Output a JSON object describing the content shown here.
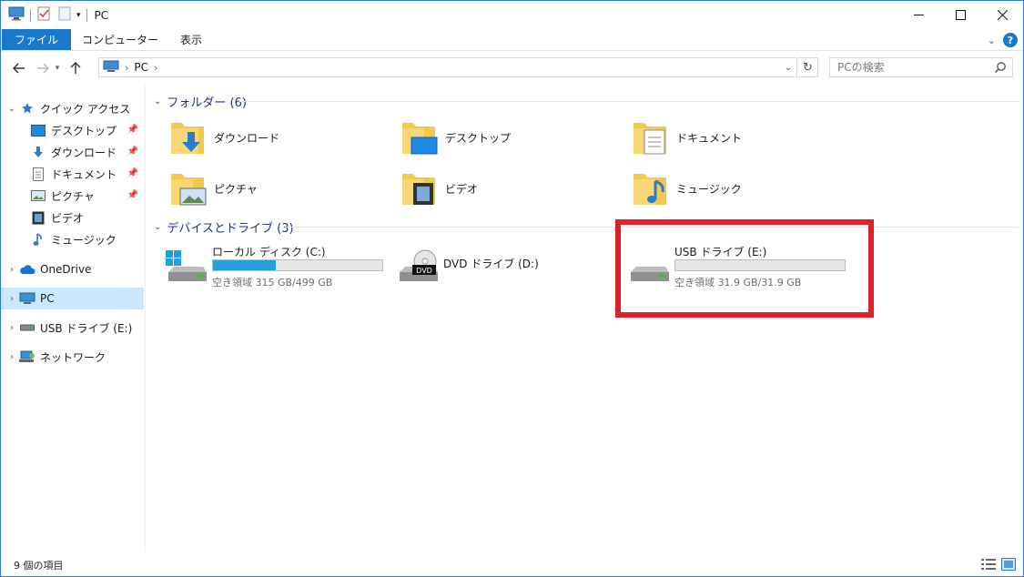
{
  "window": {
    "title": "PC"
  },
  "ribbon": {
    "tabs": [
      {
        "label": "ファイル"
      },
      {
        "label": "コンピューター"
      },
      {
        "label": "表示"
      }
    ]
  },
  "nav": {
    "address": {
      "root_icon": "computer-icon",
      "path": [
        "PC"
      ]
    },
    "search_placeholder": "PCの検索"
  },
  "sidebar": {
    "quick_access": {
      "label": "クイック アクセス",
      "items": [
        {
          "label": "デスクトップ",
          "icon": "desktop-icon",
          "pinned": true
        },
        {
          "label": "ダウンロード",
          "icon": "download-icon",
          "pinned": true
        },
        {
          "label": "ドキュメント",
          "icon": "documents-icon",
          "pinned": true
        },
        {
          "label": "ピクチャ",
          "icon": "pictures-icon",
          "pinned": true
        },
        {
          "label": "ビデオ",
          "icon": "videos-icon",
          "pinned": false
        },
        {
          "label": "ミュージック",
          "icon": "music-icon",
          "pinned": false
        }
      ]
    },
    "onedrive": {
      "label": "OneDrive"
    },
    "pc": {
      "label": "PC"
    },
    "usb": {
      "label": "USB ドライブ (E:)"
    },
    "network": {
      "label": "ネットワーク"
    }
  },
  "content": {
    "folders": {
      "header": "フォルダー (6)",
      "items": [
        {
          "label": "ダウンロード",
          "icon": "download-folder-icon"
        },
        {
          "label": "デスクトップ",
          "icon": "desktop-folder-icon"
        },
        {
          "label": "ドキュメント",
          "icon": "documents-folder-icon"
        },
        {
          "label": "ピクチャ",
          "icon": "pictures-folder-icon"
        },
        {
          "label": "ビデオ",
          "icon": "videos-folder-icon"
        },
        {
          "label": "ミュージック",
          "icon": "music-folder-icon"
        }
      ]
    },
    "drives": {
      "header": "デバイスとドライブ (3)",
      "items": [
        {
          "label": "ローカル ディスク (C:)",
          "free": "空き領域 315 GB/499 GB",
          "used_fraction": 0.369,
          "has_bar": true,
          "icon": "windows-drive-icon"
        },
        {
          "label": "DVD ドライブ (D:)",
          "free": "",
          "has_bar": false,
          "icon": "dvd-drive-icon",
          "badge": "DVD"
        },
        {
          "label": "USB ドライブ (E:)",
          "free": "空き領域 31.9 GB/31.9 GB",
          "used_fraction": 0.0,
          "has_bar": true,
          "icon": "usb-drive-icon"
        }
      ]
    }
  },
  "status": {
    "item_count": "9 個の項目"
  },
  "colors": {
    "accent": "#1979ca",
    "highlight": "#e0202a",
    "capacity_fill": "#26a0da",
    "selection": "#cce8ff"
  }
}
